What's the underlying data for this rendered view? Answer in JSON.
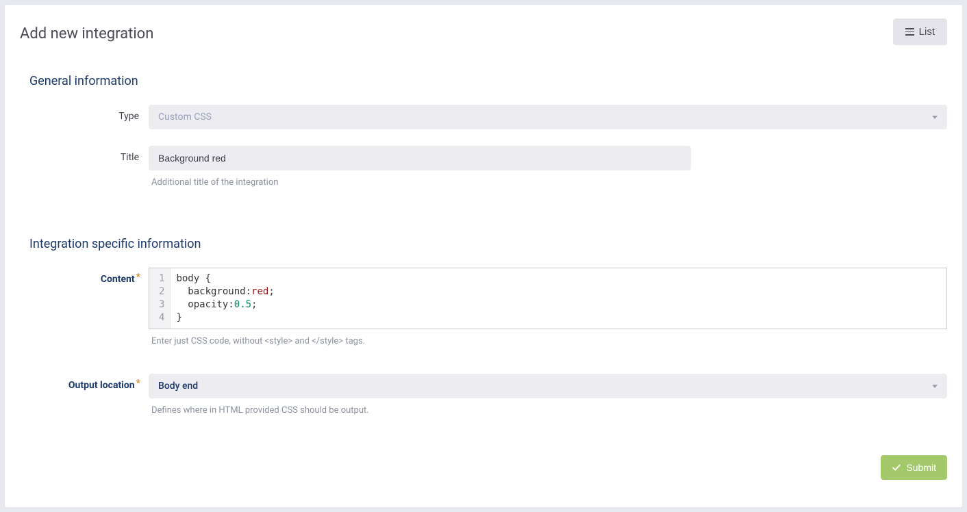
{
  "header": {
    "title": "Add new integration",
    "list_btn": "List"
  },
  "sections": {
    "general": "General information",
    "specific": "Integration specific information"
  },
  "labels": {
    "type": "Type",
    "title": "Title",
    "content": "Content",
    "output_location": "Output location"
  },
  "fields": {
    "type_selected": "Custom CSS",
    "title_value": "Background red",
    "title_hint": "Additional title of the integration",
    "content_hint": "Enter just CSS code, without <style> and </style> tags.",
    "output_location_selected": "Body end",
    "output_location_hint": "Defines where in HTML provided CSS should be output."
  },
  "code": {
    "lines": [
      "1",
      "2",
      "3",
      "4"
    ],
    "l1_sel": "body",
    "l1_brace": " {",
    "l2_indent": "  ",
    "l2_prop": "background",
    "l2_colon": ":",
    "l2_val": "red",
    "l2_semi": ";",
    "l3_indent": "  ",
    "l3_prop": "opacity",
    "l3_colon": ":",
    "l3_val": "0.5",
    "l3_semi": ";",
    "l4_brace": "}"
  },
  "actions": {
    "submit": "Submit"
  },
  "asterisk": "*"
}
